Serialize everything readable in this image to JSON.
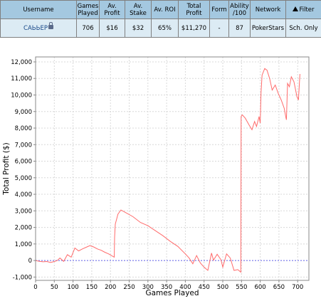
{
  "stats_table": {
    "headers": {
      "username": "Username",
      "games_played": "Games Played",
      "av_profit": "Av. Profit",
      "av_stake": "Av. Stake",
      "av_roi": "Av. ROI",
      "total_profit": "Total Profit",
      "form": "Form",
      "ability": "Ability /100",
      "network": "Network",
      "filter": "Filter"
    },
    "row": {
      "username": "CAЬЬEP",
      "games_played": "706",
      "av_profit": "$16",
      "av_stake": "$32",
      "av_roi": "65%",
      "total_profit": "$11,270",
      "form": "-",
      "ability": "87",
      "network": "PokerStars",
      "filter": "Sch. Only"
    }
  },
  "chart_data": {
    "type": "line",
    "title": "",
    "xlabel": "Games Played",
    "ylabel": "Total Profit ($)",
    "xlim": [
      0,
      730
    ],
    "ylim": [
      -1200,
      12300
    ],
    "x_ticks": [
      0,
      50,
      100,
      150,
      200,
      250,
      300,
      350,
      400,
      450,
      500,
      550,
      600,
      650,
      700
    ],
    "y_ticks": [
      -1000,
      0,
      1000,
      2000,
      3000,
      4000,
      5000,
      6000,
      7000,
      8000,
      9000,
      10000,
      11000,
      12000
    ],
    "y_tick_labels": [
      "-1,000",
      "0",
      "1,000",
      "2,000",
      "3,000",
      "4,000",
      "5,000",
      "6,000",
      "7,000",
      "8,000",
      "9,000",
      "10,000",
      "11,000",
      "12,000"
    ],
    "grid": true,
    "zero_line": true,
    "line_color": "#ff6b6b",
    "zero_line_color": "#6666ee",
    "series": [
      {
        "x": [
          0,
          10,
          20,
          30,
          40,
          50,
          58,
          65,
          75,
          85,
          95,
          105,
          115,
          125,
          135,
          145,
          155,
          165,
          175,
          185,
          195,
          210,
          211,
          213,
          220,
          228,
          240,
          260,
          280,
          300,
          320,
          340,
          360,
          380,
          400,
          410,
          420,
          430,
          440,
          450,
          460,
          470,
          475,
          485,
          495,
          500,
          510,
          520,
          530,
          540,
          548,
          549,
          552,
          560,
          570,
          578,
          585,
          590,
          597,
          600,
          602,
          605,
          612,
          618,
          625,
          632,
          640,
          648,
          656,
          664,
          668,
          670,
          673,
          678,
          683,
          690,
          698,
          702,
          706
        ],
        "y": [
          0,
          -50,
          -80,
          -60,
          -120,
          -60,
          0,
          150,
          -50,
          350,
          200,
          750,
          580,
          700,
          800,
          900,
          820,
          700,
          620,
          500,
          400,
          200,
          1400,
          2200,
          2800,
          3050,
          2900,
          2650,
          2300,
          2100,
          1800,
          1500,
          1150,
          850,
          400,
          150,
          -200,
          300,
          -150,
          -400,
          -600,
          450,
          20,
          380,
          50,
          -400,
          400,
          150,
          -600,
          -550,
          -700,
          8700,
          8800,
          8600,
          8200,
          7900,
          8400,
          8100,
          8700,
          8300,
          10100,
          11200,
          11600,
          11500,
          11000,
          10300,
          10600,
          10100,
          9700,
          9200,
          8700,
          8500,
          10700,
          10500,
          11100,
          10800,
          9900,
          9700,
          11270
        ]
      }
    ]
  }
}
